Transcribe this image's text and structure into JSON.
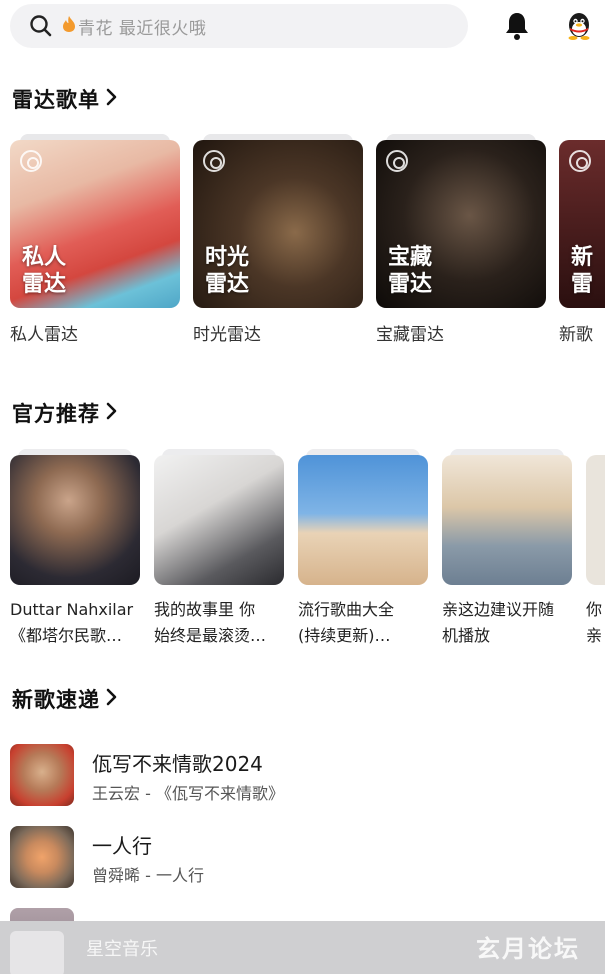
{
  "search": {
    "placeholder": "青花 最近很火哦",
    "icon": "search-icon",
    "hint_icon": "fire-icon"
  },
  "header_icons": {
    "bell": "bell-icon",
    "account": "qq-penguin-icon"
  },
  "radar": {
    "title": "雷达歌单",
    "items": [
      {
        "overlay_line1": "私人",
        "overlay_line2": "雷达",
        "caption": "私人雷达"
      },
      {
        "overlay_line1": "时光",
        "overlay_line2": "雷达",
        "caption": "时光雷达"
      },
      {
        "overlay_line1": "宝藏",
        "overlay_line2": "雷达",
        "caption": "宝藏雷达"
      },
      {
        "overlay_line1": "新",
        "overlay_line2": "雷",
        "caption": "新歌"
      }
    ]
  },
  "official": {
    "title": "官方推荐",
    "items": [
      {
        "line1": "Duttar Nahxilar",
        "line2": "《都塔尔民歌…"
      },
      {
        "line1": "我的故事里 你",
        "line2": "始终是最滚烫…"
      },
      {
        "line1": "流行歌曲大全",
        "line2": "(持续更新)…"
      },
      {
        "line1": "亲这边建议开随",
        "line2": "机播放"
      },
      {
        "line1": "你",
        "line2": "亲"
      }
    ]
  },
  "new_songs": {
    "title": "新歌速递",
    "items": [
      {
        "title": "佤写不来情歌2024",
        "subtitle": "王云宏 - 《佤写不来情歌》"
      },
      {
        "title": "一人行",
        "subtitle": "曾舜晞 - 一人行"
      }
    ]
  },
  "player": {
    "name": "星空音乐"
  },
  "watermark": "玄月论坛",
  "colors": {
    "background": "#ffffff",
    "search_bg": "#f2f2f4",
    "player_bg": "#cfcfd1",
    "fire": "#f39a2d"
  }
}
